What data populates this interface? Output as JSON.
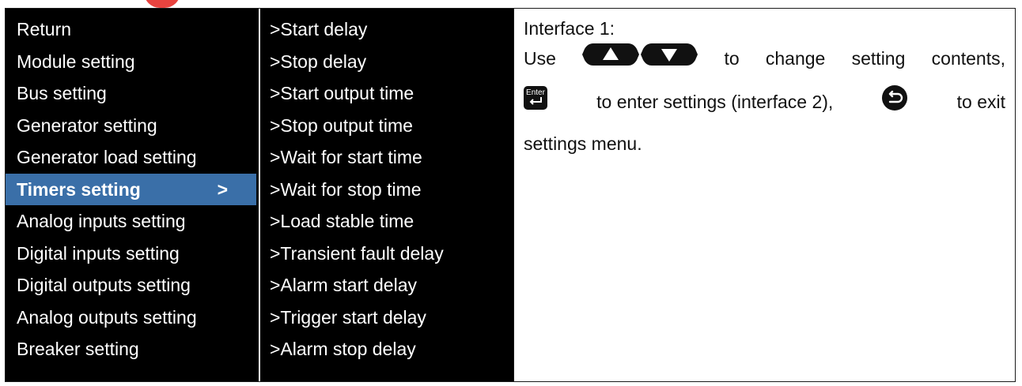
{
  "menu": {
    "items": [
      {
        "label": "Return"
      },
      {
        "label": "Module setting"
      },
      {
        "label": "Bus setting"
      },
      {
        "label": "Generator setting"
      },
      {
        "label": "Generator load setting"
      },
      {
        "label": "Timers setting",
        "arrow": ">"
      },
      {
        "label": "Analog inputs setting"
      },
      {
        "label": "Digital inputs setting"
      },
      {
        "label": "Digital outputs setting"
      },
      {
        "label": "Analog outputs setting"
      },
      {
        "label": "Breaker setting"
      }
    ],
    "selected_index": 5
  },
  "submenu": {
    "items": [
      ">Start delay",
      ">Stop delay",
      ">Start output time",
      ">Stop output time",
      ">Wait for start time",
      ">Wait for stop time",
      ">Load stable time",
      ">Transient fault delay",
      ">Alarm start delay",
      ">Trigger start delay",
      ">Alarm stop delay"
    ]
  },
  "description": {
    "heading": "Interface 1:",
    "use": "Use",
    "to": "to",
    "change": "change",
    "setting": "setting",
    "contents": "contents,",
    "enter_settings": "to enter settings (interface 2),",
    "to_exit": "to exit",
    "menu_end": "settings menu.",
    "enter_key_label": "Enter"
  },
  "colors": {
    "menu_bg": "#000000",
    "selected_bg": "#3a6fa8",
    "accent": "#e8433f"
  }
}
